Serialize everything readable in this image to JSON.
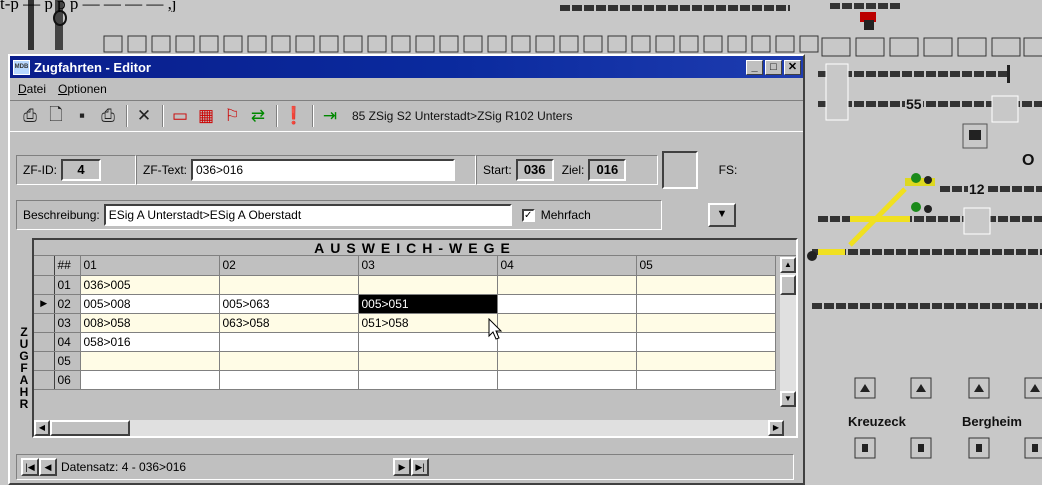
{
  "window": {
    "title": "Zugfahrten - Editor",
    "controls": {
      "minimize": "_",
      "maximize": "□",
      "close": "✕"
    }
  },
  "menu": [
    "Datei",
    "Optionen"
  ],
  "toolbar": {
    "status_text": "85 ZSig S2 Unterstadt>ZSig R102 Unters"
  },
  "form": {
    "zf_id_label": "ZF-ID:",
    "zf_id_value": "4",
    "zf_text_label": "ZF-Text:",
    "zf_text_value": "036>016",
    "start_label": "Start:",
    "start_value": "036",
    "ziel_label": "Ziel:",
    "ziel_value": "016",
    "fs_label": "FS:",
    "beschreibung_label": "Beschreibung:",
    "beschreibung_value": "ESig A Unterstadt>ESig A Oberstadt",
    "mehrfach_label": "Mehrfach",
    "mehrfach_checked": "✓"
  },
  "grid": {
    "title": "AUSWEICH-WEGE",
    "side_label": "ZUGFAHR",
    "columns": [
      "##",
      "01",
      "02",
      "03",
      "04",
      "05"
    ],
    "rows": [
      [
        "01",
        "036>005",
        "",
        "",
        "",
        ""
      ],
      [
        "02",
        "005>008",
        "005>063",
        "005>051",
        "",
        ""
      ],
      [
        "03",
        "008>058",
        "063>058",
        "051>058",
        "",
        ""
      ],
      [
        "04",
        "058>016",
        "",
        "",
        "",
        ""
      ],
      [
        "05",
        "",
        "",
        "",
        "",
        ""
      ],
      [
        "06",
        "",
        "",
        "",
        "",
        ""
      ]
    ]
  },
  "nav": {
    "record_text": "Datensatz: 4 - 036>016"
  },
  "background": {
    "track_number_55": "55",
    "track_number_12": "12",
    "stations": [
      "Kreuzeck",
      "Bergheim"
    ],
    "partial_label": "O",
    "top_text": "t-p      — p      p p      — — — —      ,j"
  },
  "colors": {
    "titlebar": "#0a1e8c",
    "selection": "#000000",
    "row_odd": "#fffce6",
    "track_yellow": "#f0e020"
  }
}
